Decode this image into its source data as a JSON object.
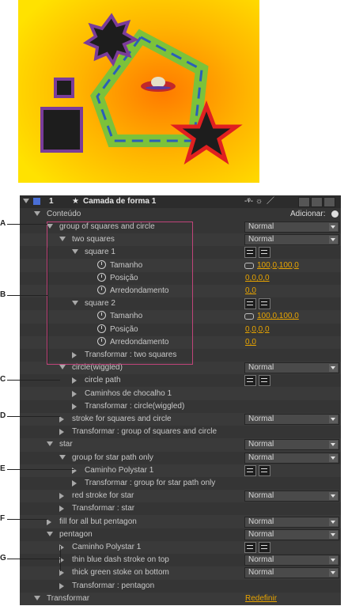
{
  "layer": {
    "number": "1",
    "name": "Camada de forma 1",
    "label_color": "#4a6fd6"
  },
  "contents": {
    "label": "Conteúdo",
    "add_label": "Adicionar:"
  },
  "blend_default": "Normal",
  "rows": [
    {
      "label": "group of squares and circle",
      "select": "Normal"
    },
    {
      "label": "two squares",
      "select": "Normal"
    },
    {
      "label": "square 1"
    },
    {
      "label": "Tamanho",
      "value": "100,0,100,0"
    },
    {
      "label": "Posição",
      "value": "0,0,0,0"
    },
    {
      "label": "Arredondamento",
      "value": "0,0"
    },
    {
      "label": "square 2"
    },
    {
      "label": "Tamanho",
      "value": "100,0,100,0"
    },
    {
      "label": "Posição",
      "value": "0,0,0,0"
    },
    {
      "label": "Arredondamento",
      "value": "0,0"
    },
    {
      "label": "Transformar : two squares"
    },
    {
      "label": "circle(wiggled)",
      "select": "Normal"
    },
    {
      "label": "circle path"
    },
    {
      "label": "Caminhos de chocalho 1"
    },
    {
      "label": "Transformar : circle(wiggled)"
    },
    {
      "label": "stroke for squares and circle",
      "select": "Normal"
    },
    {
      "label": "Transformar : group of squares and circle"
    },
    {
      "label": "star",
      "select": "Normal"
    },
    {
      "label": "group for star path only",
      "select": "Normal"
    },
    {
      "label": "Caminho Polystar 1"
    },
    {
      "label": "Transformar : group for star path only"
    },
    {
      "label": "red stroke for star",
      "select": "Normal"
    },
    {
      "label": "Transformar : star"
    },
    {
      "label": "fill for all but pentagon",
      "select": "Normal"
    },
    {
      "label": "pentagon",
      "select": "Normal"
    },
    {
      "label": "Caminho Polystar 1"
    },
    {
      "label": "thin blue dash stroke on top",
      "select": "Normal"
    },
    {
      "label": "thick green stoke on bottom",
      "select": "Normal"
    },
    {
      "label": "Transformar : pentagon"
    },
    {
      "label": "Transformar",
      "value": "Redefinir"
    }
  ],
  "callouts": [
    "A",
    "B",
    "C",
    "D",
    "E",
    "F",
    "G"
  ],
  "colors": {
    "panel_bg": "#3a3a3a",
    "value": "#e8a400",
    "highlight": "#c0447a"
  }
}
